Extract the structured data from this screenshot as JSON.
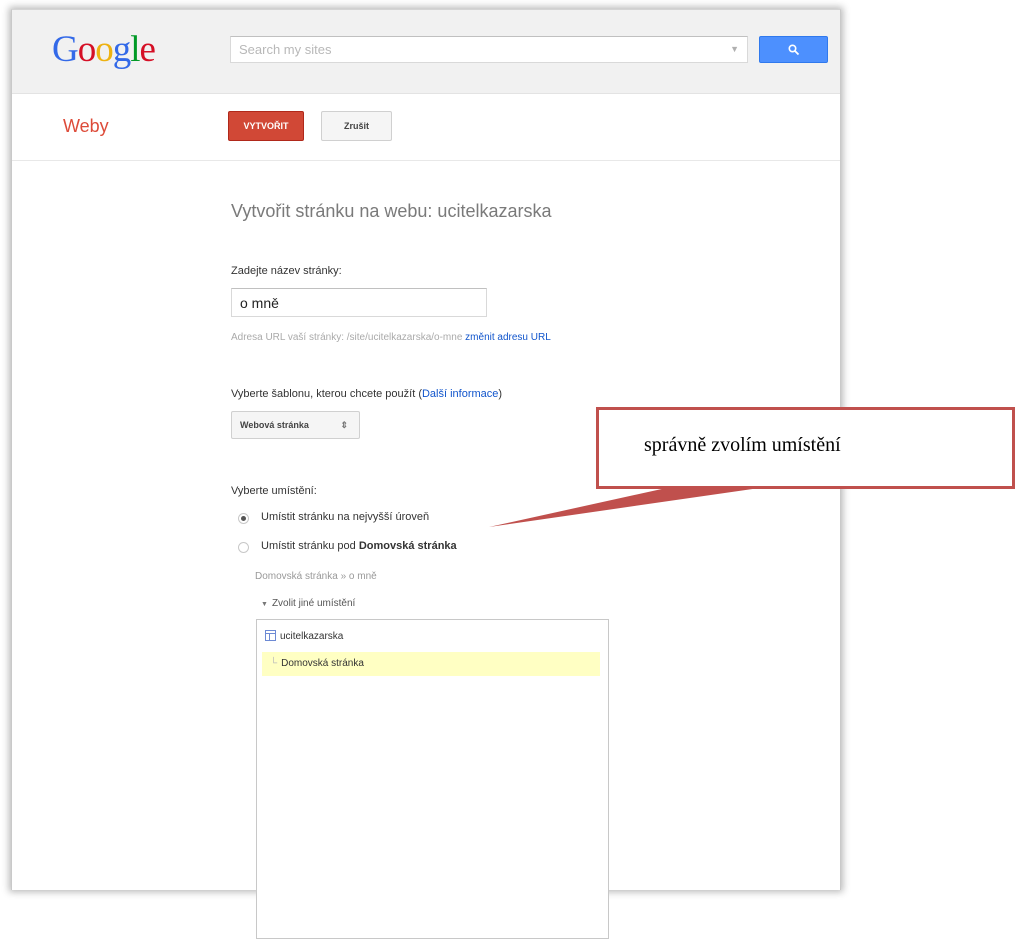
{
  "header": {
    "logo_letters": [
      {
        "ch": "G",
        "color": "#3369e8"
      },
      {
        "ch": "o",
        "color": "#d50f25"
      },
      {
        "ch": "o",
        "color": "#eeb211"
      },
      {
        "ch": "g",
        "color": "#3369e8"
      },
      {
        "ch": "l",
        "color": "#009925"
      },
      {
        "ch": "e",
        "color": "#d50f25"
      }
    ],
    "search_placeholder": "Search my sites",
    "search_icon": "search-icon"
  },
  "subbar": {
    "app_name": "Weby",
    "create_label": "VYTVOŘIT",
    "cancel_label": "Zrušit"
  },
  "form": {
    "page_title": "Vytvořit stránku na webu: ucitelkazarska",
    "name_label": "Zadejte název stránky:",
    "name_value": "o mně",
    "url_prefix": "Adresa URL vaší stránky: /site/ucitelkazarska/o-mne",
    "url_change_link": "změnit adresu URL",
    "template_label_prefix": "Vyberte šablonu, kterou chcete použít (",
    "template_info_link": "Další informace",
    "template_label_suffix": ")",
    "template_value": "Webová stránka",
    "placement_label": "Vyberte umístění:",
    "option_top": "Umístit stránku na nejvyšší úroveň",
    "option_under_prefix": "Umístit stránku pod ",
    "option_under_target": "Domovská stránka",
    "breadcrumb": "Domovská stránka » o mně",
    "choose_other": "Zvolit jiné umístění",
    "tree_root": "ucitelkazarska",
    "tree_child": "Domovská stránka"
  },
  "annotation": {
    "callout_text": "správně zvolím umístění",
    "color": "#c0504d"
  }
}
